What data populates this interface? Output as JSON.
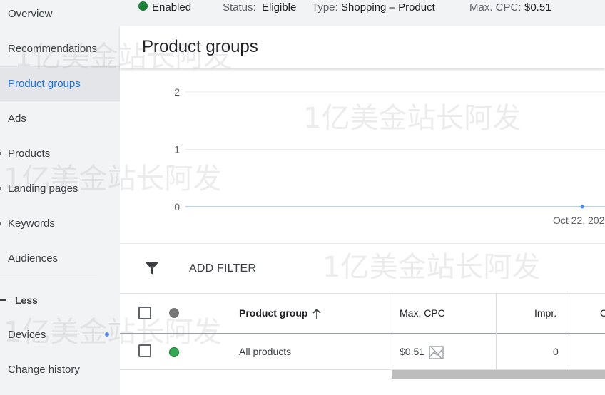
{
  "sidebar": {
    "items": [
      {
        "label": "Overview"
      },
      {
        "label": "Recommendations"
      },
      {
        "label": "Product groups"
      },
      {
        "label": "Ads"
      },
      {
        "label": "Products"
      },
      {
        "label": "Landing pages"
      },
      {
        "label": "Keywords"
      },
      {
        "label": "Audiences"
      }
    ],
    "less_label": "Less",
    "extra_items": [
      {
        "label": "Devices"
      },
      {
        "label": "Change history"
      }
    ]
  },
  "status_bar": {
    "state": "Enabled",
    "status_prefix": "Status:",
    "status_value": "Eligible",
    "type_prefix": "Type:",
    "type_value": "Shopping – Product",
    "cpc_prefix": "Max. CPC:",
    "cpc_value": "$0.51"
  },
  "page": {
    "title": "Product groups"
  },
  "chart_data": {
    "type": "line",
    "y_ticks": [
      "2",
      "1",
      "0"
    ],
    "ylim": [
      0,
      2
    ],
    "x_tick_labels": [
      "Oct 22, 202"
    ],
    "series": [
      {
        "values": [
          0,
          0
        ]
      }
    ],
    "grid": true
  },
  "filter": {
    "add_filter_label": "ADD FILTER"
  },
  "table": {
    "columns": {
      "product_group": "Product group",
      "max_cpc": "Max. CPC",
      "impr": "Impr.",
      "clicks_partial": "C"
    },
    "rows": [
      {
        "product_group": "All products",
        "max_cpc": "$0.51",
        "impr": "0"
      }
    ]
  },
  "watermark": "1亿美金站长阿发",
  "colors": {
    "accent": "#1a73e8",
    "enabled_green": "#188038",
    "series_blue": "#4285f4"
  }
}
